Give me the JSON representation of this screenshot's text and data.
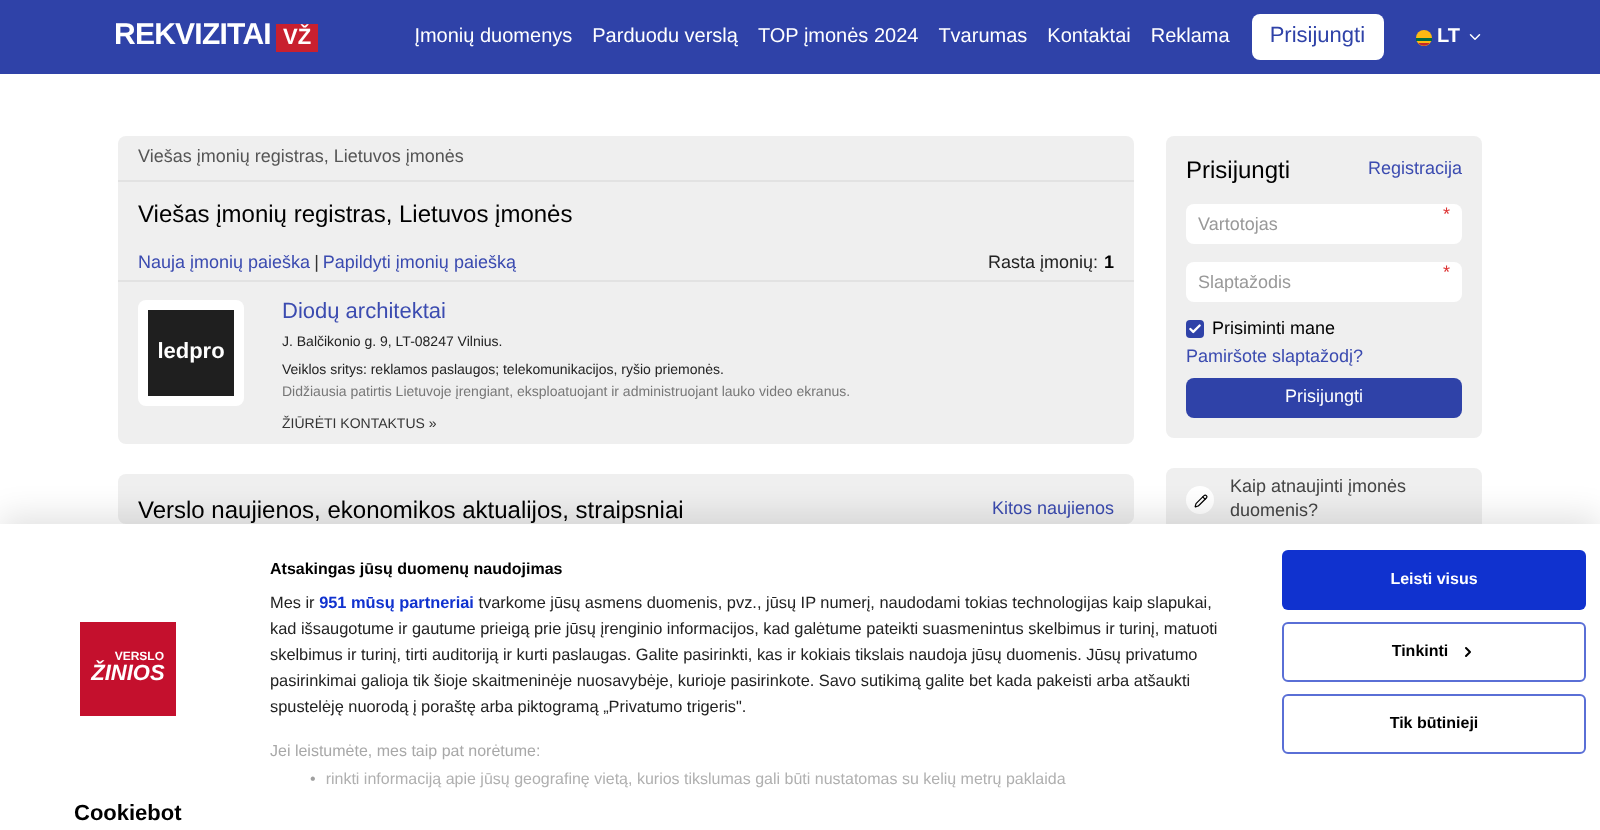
{
  "header": {
    "logo": "REKVIZITAI",
    "logo_badge": "VŽ",
    "nav": [
      "Įmonių duomenys",
      "Parduodu verslą",
      "TOP įmonės 2024",
      "Tvarumas",
      "Kontaktai",
      "Reklama"
    ],
    "login_button": "Prisijungti",
    "language": "LT"
  },
  "register": {
    "breadcrumb": "Viešas įmonių registras, Lietuvos įmonės",
    "title": "Viešas įmonių registras, Lietuvos įmonės",
    "links": [
      "Nauja įmonių paieška",
      "Papildyti įmonių paiešką"
    ],
    "separator": "|",
    "found_label": "Rasta įmonių:",
    "found_count": "1",
    "companies": [
      {
        "logo_text": "ledpro",
        "name": "Diodų architektai",
        "address": "J. Balčikonio g. 9, LT-08247 Vilnius.",
        "activities": "Veiklos sritys: reklamos paslaugos; telekomunikacijos, ryšio priemonės.",
        "description": "Didžiausia patirtis Lietuvoje įrengiant, eksploatuojant ir administruojant lauko video ekranus.",
        "contacts_link": "ŽIŪRĖTI KONTAKTUS »"
      }
    ]
  },
  "news": {
    "title": "Verslo naujienos, ekonomikos aktualijos, straipsniai",
    "more_link": "Kitos naujienos"
  },
  "login": {
    "title": "Prisijungti",
    "register_link": "Registracija",
    "fields": [
      {
        "placeholder": "Vartotojas",
        "required_mark": "*"
      },
      {
        "placeholder": "Slaptažodis",
        "required_mark": "*"
      }
    ],
    "remember": {
      "label": "Prisiminti mane",
      "checked": true
    },
    "forgot_link": "Pamiršote slaptažodį?",
    "submit": "Prisijungti"
  },
  "help": {
    "text": "Kaip atnaujinti įmonės duomenis?"
  },
  "cookie_banner": {
    "logo_top": "VERSLO",
    "logo_bottom": "ŽINIOS",
    "title": "Atsakingas jūsų duomenų naudojimas",
    "body": "Mes ir **951 mūsų partneriai** tvarkome jūsų asmens duomenis, pvz., jūsų IP numerį, naudodami tokias technologijas kaip slapukai, kad išsaugotume ir gautume prieigą prie jūsų įrenginio informacijos, kad galėtume pateikti suasmenintus skelbimus ir turinį, matuoti skelbimus ir turinį, tirti auditoriją ir kurti paslaugas. Galite pasirinkti, kas ir kokiais tikslais naudoja jūsų duomenis. Jūsų privatumo pasirinkimai galioja tik šioje skaitmeninėje nuosavybėje, kurioje pasirinkote. Savo sutikimą galite bet kada pakeisti arba atšaukti spustelėję nuorodą į poraštę arba piktogramą „Privatumo trigeris\".",
    "faded_intro": "Jei leistumėte, mes taip pat norėtume:",
    "bullet": "•",
    "faded_items": [
      "rinkti informaciją apie jūsų geografinę vietą, kurios tikslumas gali būti nustatomas su kelių metrų paklaida"
    ],
    "brand": "Cookiebot",
    "buttons": [
      {
        "label": "Leisti visus",
        "kind": "primary"
      },
      {
        "label": "Tinkinti",
        "kind": "chevron"
      },
      {
        "label": "Tik būtinieji",
        "kind": "outline"
      }
    ]
  }
}
